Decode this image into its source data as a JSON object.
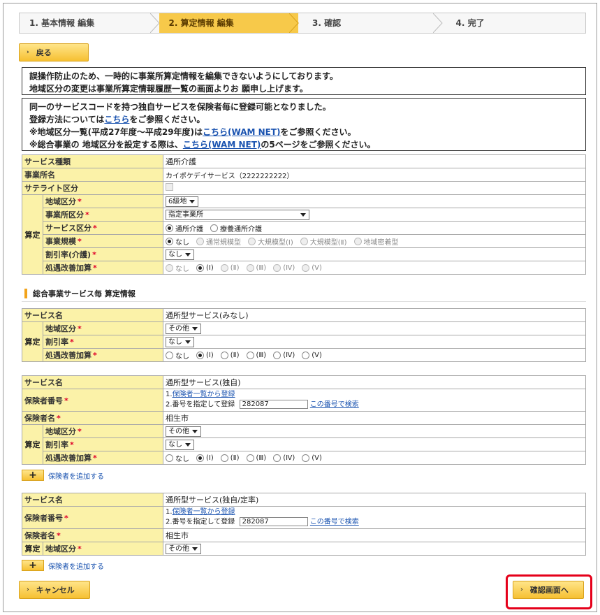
{
  "steps": [
    {
      "label": "1. 基本情報 編集"
    },
    {
      "label": "2. 算定情報 編集"
    },
    {
      "label": "3. 確認"
    },
    {
      "label": "4. 完了"
    }
  ],
  "back_label": "戻る",
  "notice1": {
    "line1": "誤操作防止のため、一時的に事業所算定情報を編集できないようにしております。",
    "line2": "地域区分の変更は事業所算定情報履歴一覧の画面よりお 願申し上げます。"
  },
  "notice2": {
    "line1": "同一のサービスコードを持つ独自サービスを保険者毎に登録可能となりました。",
    "line2_pre": "登録方法については",
    "line2_link": "こちら",
    "line2_post": "をご参照ください。",
    "line3_pre": "※地域区分一覧(平成27年度～平成29年度)は",
    "line3_link": "こちら(WAM NET)",
    "line3_post": "をご参照ください。",
    "line4_pre": "※総合事業の 地域区分を設定する際は、",
    "line4_link": "こちら(WAM NET)",
    "line4_post": "の5ページをご参照ください。"
  },
  "main": {
    "service_type_label": "サービス種類",
    "service_type_value": "通所介護",
    "office_name_label": "事業所名",
    "office_name_value": "カイポケデイサービス（2222222222）",
    "satellite_label": "サテライト区分",
    "group_label": "算定",
    "area_label": "地域区分",
    "area_value": "6級地",
    "office_kubun_label": "事業所区分",
    "office_kubun_value": "指定事業所",
    "service_kubun_label": "サービス区分",
    "service_kubun_opts": [
      "通所介護",
      "療養通所介護"
    ],
    "scale_label": "事業規模",
    "scale_opts": [
      "なし",
      "通常規模型",
      "大規模型(Ⅰ)",
      "大規模型(Ⅱ)",
      "地域密着型"
    ],
    "discount_label": "割引率(介護)",
    "discount_value": "なし",
    "treat_label": "処遇改善加算",
    "treat_opts": [
      "なし",
      "(Ⅰ)",
      "(Ⅱ)",
      "(Ⅲ)",
      "(Ⅳ)",
      "(Ⅴ)"
    ]
  },
  "section_title": "総合事業サービス毎 算定情報",
  "s1": {
    "name_label": "サービス名",
    "name_value": "通所型サービス(みなし)",
    "group_label": "算定",
    "area_label": "地域区分",
    "area_value": "その他",
    "discount_label": "割引率",
    "discount_value": "なし",
    "treat_label": "処遇改善加算",
    "treat_opts": [
      "なし",
      "(Ⅰ)",
      "(Ⅱ)",
      "(Ⅲ)",
      "(Ⅳ)",
      "(Ⅴ)"
    ]
  },
  "s2": {
    "name_label": "サービス名",
    "name_value": "通所型サービス(独自)",
    "insurer_no_label": "保険者番号",
    "opt1_prefix": "1.",
    "opt1_link": "保険者一覧から登録",
    "opt2_text": "2.番号を指定して登録",
    "insurer_no_value": "282087",
    "search_link": "この番号で検索",
    "insurer_name_label": "保険者名",
    "insurer_name_value": "相生市",
    "group_label": "算定",
    "area_label": "地域区分",
    "area_value": "その他",
    "discount_label": "割引率",
    "discount_value": "なし",
    "treat_label": "処遇改善加算",
    "treat_opts": [
      "なし",
      "(Ⅰ)",
      "(Ⅱ)",
      "(Ⅲ)",
      "(Ⅳ)",
      "(Ⅴ)"
    ],
    "add_label": "保険者を追加する"
  },
  "s3": {
    "name_label": "サービス名",
    "name_value": "通所型サービス(独自/定率)",
    "insurer_no_label": "保険者番号",
    "opt1_prefix": "1.",
    "opt1_link": "保険者一覧から登録",
    "opt2_text": "2.番号を指定して登録",
    "insurer_no_value": "282087",
    "search_link": "この番号で検索",
    "insurer_name_label": "保険者名",
    "insurer_name_value": "相生市",
    "group_label": "算定",
    "area_label": "地域区分",
    "area_value": "その他",
    "add_label": "保険者を追加する"
  },
  "cancel_label": "キャンセル",
  "confirm_label": "確認画面へ",
  "colors": {
    "accent": "#f7c94a",
    "label_bg": "#fbf2a8",
    "link": "#1a53b0",
    "required": "#e0002a",
    "highlight": "#e5001a"
  }
}
